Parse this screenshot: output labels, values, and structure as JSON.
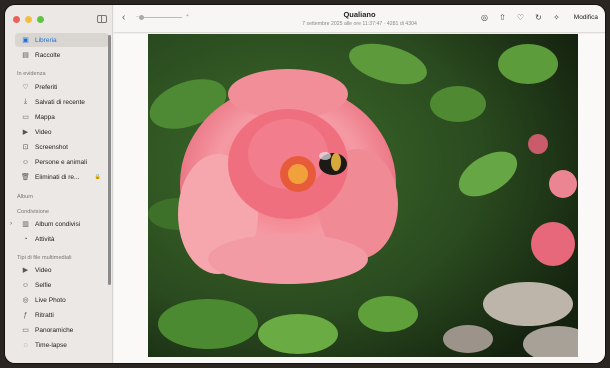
{
  "sidebar": {
    "libreria": "Libreria",
    "raccolte": "Raccolte",
    "section_in_evidenza": "In evidenza",
    "preferiti": "Preferiti",
    "salvati": "Salvati di recente",
    "mappa": "Mappa",
    "video": "Video",
    "screenshot": "Screenshot",
    "persone": "Persone e animali",
    "eliminati": "Eliminati di re...",
    "section_album": "Album",
    "section_condivisione": "Condivisione",
    "album_condivisi": "Album condivisi",
    "attivita": "Attività",
    "section_tipi": "Tipi di file multimediali",
    "video2": "Video",
    "selfie": "Selfie",
    "live_photo": "Live Photo",
    "ritratti": "Ritratti",
    "panoramiche": "Panoramiche",
    "time_lapse": "Time-lapse"
  },
  "toolbar": {
    "title": "Qualiano",
    "subtitle": "7 settembre 2025 alle ore 11:37:47  ·  4281 di 4304",
    "edit": "Modifica"
  },
  "colors": {
    "accent": "#1f6fde",
    "rose": "#f07e8a"
  }
}
